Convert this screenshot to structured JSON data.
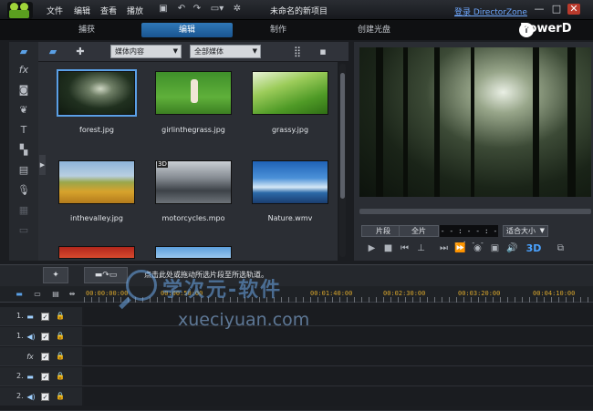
{
  "titlebar": {
    "menus": [
      "文件",
      "编辑",
      "查看",
      "播放"
    ],
    "project_title": "未命名的新项目",
    "login_link": "登录 DirectorZone",
    "minimize": "—",
    "maximize": "□",
    "close": "✕"
  },
  "mode_tabs": [
    "捕获",
    "编辑",
    "制作",
    "创建光盘"
  ],
  "active_tab": "编辑",
  "brand": "PowerD",
  "library": {
    "dropdown_media": "媒体内容",
    "dropdown_filter": "全部媒体",
    "items": [
      {
        "label": "forest.jpg",
        "selected": true
      },
      {
        "label": "girlinthegrass.jpg",
        "selected": false
      },
      {
        "label": "grassy.jpg",
        "selected": false
      },
      {
        "label": "inthevalley.jpg",
        "selected": false
      },
      {
        "label": "motorcycles.mpo",
        "selected": false,
        "badge": "3D"
      },
      {
        "label": "Nature.wmv",
        "selected": false
      }
    ]
  },
  "preview": {
    "clip_button": "片段",
    "full_button": "全片",
    "timecode": "- - : - - : - - : - -",
    "fit_dropdown": "适合大小",
    "ctrl_3d": "3D"
  },
  "timeline": {
    "hint": "点击此处或拖动所选片段至所选轨道。",
    "ruler_labels": [
      "00:00:00:00",
      "00:00:50:00",
      "00:01:40:00",
      "00:02:30:00",
      "00:03:20:00",
      "00:04:10:00"
    ],
    "tracks": [
      {
        "num": "1.",
        "type": "video",
        "icon": "▬"
      },
      {
        "num": "1.",
        "type": "audio",
        "icon": "◀)"
      },
      {
        "num": "",
        "type": "fx",
        "icon": "fx"
      },
      {
        "num": "2.",
        "type": "video",
        "icon": "▬"
      },
      {
        "num": "2.",
        "type": "audio",
        "icon": "◀)"
      }
    ]
  },
  "watermark": {
    "logo_text": "学次元-软件",
    "url_text": "xueciyuan.com"
  }
}
